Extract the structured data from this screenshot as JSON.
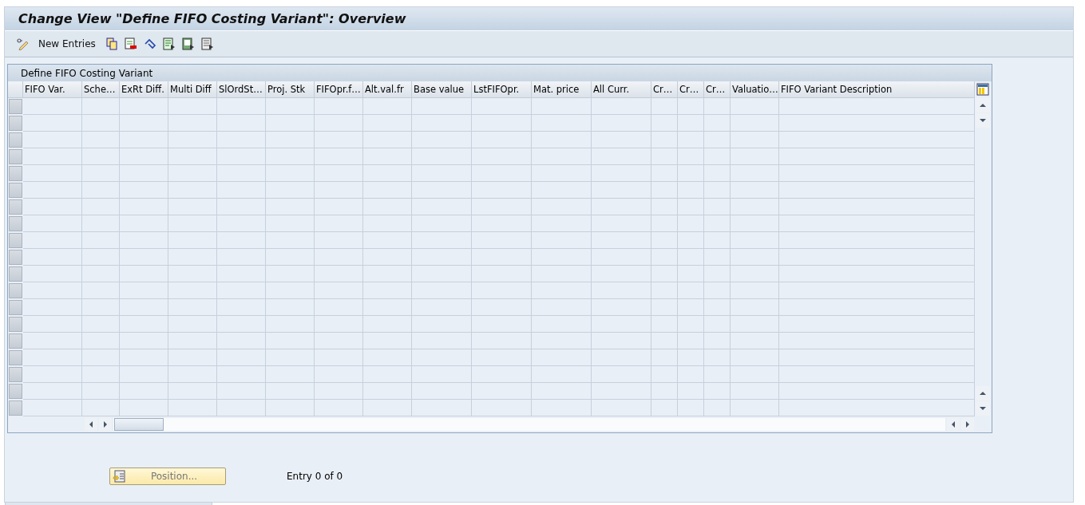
{
  "window": {
    "title": "Change View \"Define FIFO Costing Variant\": Overview"
  },
  "toolbar": {
    "new_entries": "New Entries"
  },
  "table": {
    "title": "Define FIFO Costing Variant",
    "columns": [
      "FIFO Var.",
      "Sche…",
      "ExRt Diff.",
      "Multi Diff",
      "SlOrdSt…",
      "Proj. Stk",
      "FIFOpr.f…",
      "Alt.val.fr",
      "Base value",
      "LstFIFOpr.",
      "Mat. price",
      "All Curr.",
      "Cr…",
      "Cr…",
      "Cr…",
      "Valuatio…",
      "FIFO Variant Description"
    ]
  },
  "footer": {
    "position_button": "Position...",
    "entry_count": "Entry 0 of 0"
  }
}
